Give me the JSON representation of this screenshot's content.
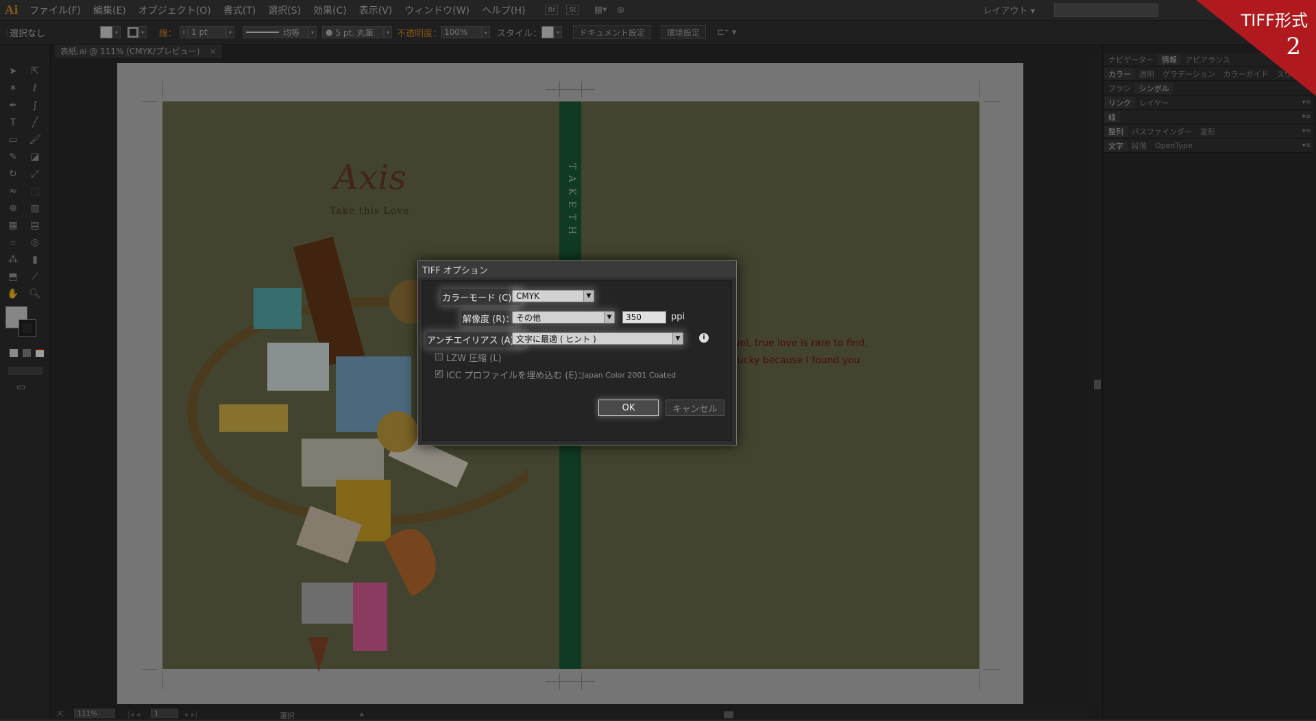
{
  "menubar": {
    "logo": "Ai",
    "items": [
      "ファイル(F)",
      "編集(E)",
      "オブジェクト(O)",
      "書式(T)",
      "選択(S)",
      "効果(C)",
      "表示(V)",
      "ウィンドウ(W)",
      "ヘルプ(H)"
    ],
    "bridge": "Br",
    "stock": "St",
    "workspace": "レイアウト"
  },
  "control": {
    "selection": "選択なし",
    "stroke_label": "線：",
    "stroke_value": "1 pt",
    "stroke_style": "均等",
    "brush": "5 pt. 丸筆",
    "opacity_label": "不透明度：",
    "opacity_value": "100%",
    "style_label": "スタイル：",
    "doc_setup": "ドキュメント設定",
    "prefs": "環境設定"
  },
  "document": {
    "tab": "表紙.ai @ 111% (CMYK/プレビュー)",
    "close": "×"
  },
  "artwork": {
    "logo": "Axis",
    "tagline": "Take this Love",
    "spine_text": "T A K E   T H",
    "lyric1": "wel, true love is rare to find,",
    "lyric2": "lucky because I found you"
  },
  "status": {
    "zoom": "111%",
    "page": "1",
    "mode": "選択"
  },
  "panels": {
    "row1": [
      "ナビゲーター",
      "情報",
      "アピアランス"
    ],
    "row2": [
      "カラー",
      "透明",
      "グラデーション",
      "カラーガイド",
      "スウォッチ"
    ],
    "row3": [
      "ブラシ",
      "シンボル"
    ],
    "row4": [
      "リンク",
      "レイヤー"
    ],
    "row5": [
      "線"
    ],
    "row6": [
      "整列",
      "パスファインダー",
      "変形"
    ],
    "row7": [
      "文字",
      "段落",
      "OpenType"
    ]
  },
  "badge": {
    "title": "TIFF形式",
    "number": "2"
  },
  "dialog": {
    "title": "TIFF オプション",
    "color_mode_label": "カラーモード (C)：",
    "color_mode_value": "CMYK",
    "resolution_label": "解像度 (R)：",
    "resolution_value": "その他",
    "resolution_ppi": "350",
    "ppi_unit": "ppi",
    "antialias_label": "アンチエイリアス (A)：",
    "antialias_value": "文字に最適 ( ヒント )",
    "lzw_label": "LZW 圧縮 (L)",
    "lzw_checked": false,
    "icc_label": "ICC プロファイルを埋め込む (E)：",
    "icc_checked": true,
    "icc_profile": "Japan Color 2001 Coated",
    "ok": "OK",
    "cancel": "キャンセル"
  },
  "colors": {
    "accent_red": "#b01a1f",
    "spine_green": "#1b5e39",
    "cover_olive": "#6d6f4d"
  }
}
